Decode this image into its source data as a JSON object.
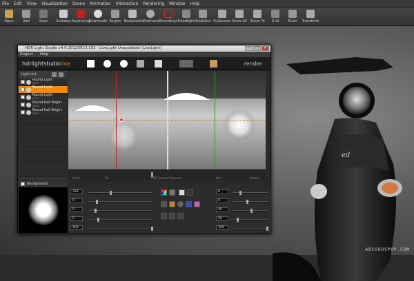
{
  "app_menu": [
    "File",
    "Edit",
    "View",
    "Visualization",
    "Scene",
    "Animation",
    "Interaction",
    "Rendering",
    "Window",
    "Help"
  ],
  "toolbar": [
    {
      "label": "Open",
      "icon": "folder-icon"
    },
    {
      "label": "Add",
      "icon": "add-icon"
    },
    {
      "label": "Save",
      "icon": "save-icon"
    },
    {
      "label": "Antialias",
      "icon": "antialias-icon"
    },
    {
      "label": "Raytracing",
      "icon": "raytracing-icon"
    },
    {
      "label": "Downscale",
      "icon": "downscale-icon"
    },
    {
      "label": "Region",
      "icon": "region-icon"
    },
    {
      "label": "Backplate",
      "icon": "backplate-icon"
    },
    {
      "label": "Wireframe",
      "icon": "wireframe-icon"
    },
    {
      "label": "Boundings",
      "icon": "boundings-icon"
    },
    {
      "label": "Headlight",
      "icon": "headlight-icon"
    },
    {
      "label": "Statistics",
      "icon": "statistics-icon"
    },
    {
      "label": "Fullscreen",
      "icon": "fullscreen-icon"
    },
    {
      "label": "Show All",
      "icon": "show-all-icon"
    },
    {
      "label": "Zoom To",
      "icon": "zoom-to-icon"
    },
    {
      "label": "Grid",
      "icon": "grid-icon"
    },
    {
      "label": "Ruler",
      "icon": "ruler-icon"
    },
    {
      "label": "Transform",
      "icon": "transform-icon"
    }
  ],
  "hdr_window": {
    "title": "HDR Light Studio v4.0.20120923.103 - LiveLight Unavailable [LiveLight]",
    "menu": [
      "Project",
      "Help"
    ],
    "logo_a": "hdrlightstudio",
    "logo_b": "live",
    "render_label": "render",
    "light_list_title": "Light List",
    "lights": [
      {
        "name": "Round Light",
        "sub": "0001",
        "selected": false
      },
      {
        "name": "Round Light",
        "sub": "0002",
        "selected": true
      },
      {
        "name": "Round Light",
        "sub": "0003",
        "selected": false
      },
      {
        "name": "Round Half Bright",
        "sub": "0004",
        "selected": false
      },
      {
        "name": "Round Half Bright",
        "sub": "0005",
        "selected": false
      }
    ],
    "background_label": "Background",
    "canvas_bar": {
      "left": "Scale",
      "mid_left": "Pin",
      "center": "HDR Canvas Exposure",
      "mid_right": "Blur",
      "right": "History"
    },
    "numeric_fields": [
      "328",
      "0",
      "0",
      "0",
      "100"
    ],
    "right_fields": [
      "6",
      "0",
      "49",
      "90",
      "100"
    ],
    "swatch_colors": [
      "#d02020",
      "#f08000",
      "#e0c000",
      "#3060d0",
      "#c040c0",
      "#808080"
    ]
  },
  "watermark": "ABCGOOSPHP.COM"
}
